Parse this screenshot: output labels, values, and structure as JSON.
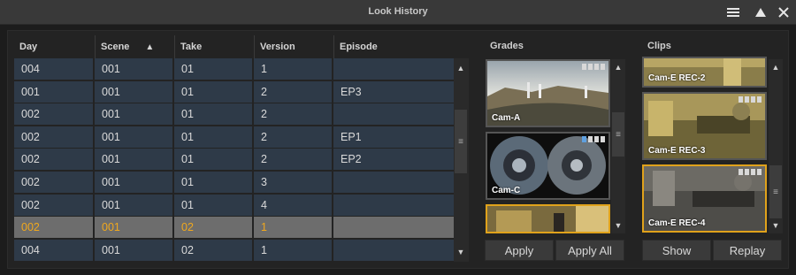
{
  "window": {
    "title": "Look History",
    "icons": [
      "menu-icon",
      "collapse-icon",
      "close-icon"
    ]
  },
  "table": {
    "columns": [
      "Day",
      "Scene",
      "Take",
      "Version",
      "Episode"
    ],
    "sort_column": "Scene",
    "sort_icon": "▲",
    "rows": [
      {
        "day": "004",
        "scene": "001",
        "take": "01",
        "version": "1",
        "episode": ""
      },
      {
        "day": "001",
        "scene": "001",
        "take": "01",
        "version": "2",
        "episode": "EP3"
      },
      {
        "day": "002",
        "scene": "001",
        "take": "01",
        "version": "2",
        "episode": ""
      },
      {
        "day": "002",
        "scene": "001",
        "take": "01",
        "version": "2",
        "episode": "EP1"
      },
      {
        "day": "002",
        "scene": "001",
        "take": "01",
        "version": "2",
        "episode": "EP2"
      },
      {
        "day": "002",
        "scene": "001",
        "take": "01",
        "version": "3",
        "episode": ""
      },
      {
        "day": "002",
        "scene": "001",
        "take": "01",
        "version": "4",
        "episode": ""
      },
      {
        "day": "002",
        "scene": "001",
        "take": "02",
        "version": "1",
        "episode": ""
      },
      {
        "day": "004",
        "scene": "001",
        "take": "02",
        "version": "1",
        "episode": ""
      }
    ],
    "selected_row": 7,
    "selected_color": "#f0a81d"
  },
  "grades": {
    "title": "Grades",
    "tiles": [
      {
        "label": "Cam-A"
      },
      {
        "label": "Cam-C"
      },
      {
        "label": ""
      }
    ],
    "apply_label": "Apply",
    "apply_all_label": "Apply All"
  },
  "clips": {
    "title": "Clips",
    "tiles": [
      {
        "label": "Cam-E REC-2"
      },
      {
        "label": "Cam-E REC-3"
      },
      {
        "label": "Cam-E REC-4"
      }
    ],
    "show_label": "Show",
    "replay_label": "Replay"
  },
  "scroll": {
    "up_glyph": "▲",
    "down_glyph": "▼",
    "grip_glyph": "≡"
  }
}
